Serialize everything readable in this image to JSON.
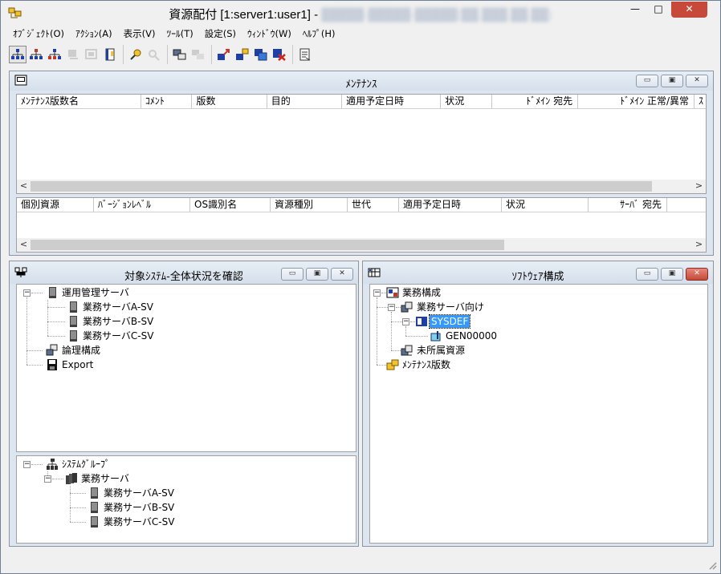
{
  "window": {
    "title_main": "資源配付 [1:server1:user1] -",
    "title_blur": "█████-█████-█████(██.███.██.██)",
    "min": "—",
    "max": "□",
    "close": "✕"
  },
  "menu": [
    "ｵﾌﾞｼﾞｪｸﾄ(O)",
    "ｱｸｼｮﾝ(A)",
    "表示(V)",
    "ﾂｰﾙ(T)",
    "設定(S)",
    "ｳｨﾝﾄﾞｳ(W)",
    "ﾍﾙﾌﾟ(H)"
  ],
  "toolbar": {
    "icons": [
      "tree-view-icon",
      "tree-alt-icon",
      "tree-red-icon",
      "disabled-icon-1",
      "disabled-icon-2",
      "document-icon",
      "pencil-icon",
      "disabled-search-icon",
      "terminal-icon",
      "disabled-terminal-icon",
      "move-icon",
      "transfer-icon",
      "window-icon",
      "delete-icon",
      "export-icon"
    ]
  },
  "maintenance": {
    "title": "ﾒﾝﾃﾅﾝｽ",
    "columns": [
      "ﾒﾝﾃﾅﾝｽ版数名",
      "ｺﾒﾝﾄ",
      "版数",
      "目的",
      "適用予定日時",
      "状況",
      "ﾄﾞﾒｲﾝ 宛先",
      "ﾄﾞﾒｲﾝ 正常/異常",
      "ｽ"
    ],
    "columns2": [
      "個別資源",
      "ﾊﾞｰｼﾞｮﾝﾚﾍﾞﾙ",
      "OS識別名",
      "資源種別",
      "世代",
      "適用予定日時",
      "状況",
      "ｻｰﾊﾞ 宛先"
    ]
  },
  "target": {
    "title": "対象ｼｽﾃﾑ-全体状況を確認",
    "tree1": {
      "root": "運用管理サーバ",
      "children": [
        "業務サーバA-SV",
        "業務サーバB-SV",
        "業務サーバC-SV"
      ],
      "logical": "論理構成",
      "export": "Export"
    },
    "tree2": {
      "root": "ｼｽﾃﾑｸﾞﾙｰﾌﾟ",
      "group": "業務サーバ",
      "children": [
        "業務サーバA-SV",
        "業務サーバB-SV",
        "業務サーバC-SV"
      ]
    }
  },
  "software": {
    "title": "ｿﾌﾄｳｪｱ構成",
    "root": "業務構成",
    "sub": "業務サーバ向け",
    "sysdef": "SYSDEF",
    "gen": "GEN00000",
    "unassigned": "未所属資源",
    "maint": "ﾒﾝﾃﾅﾝｽ版数"
  },
  "scroll": {
    "left": "<",
    "right": ">"
  },
  "panel_buttons": {
    "min": "▭",
    "max": "▣",
    "close": "✕"
  }
}
